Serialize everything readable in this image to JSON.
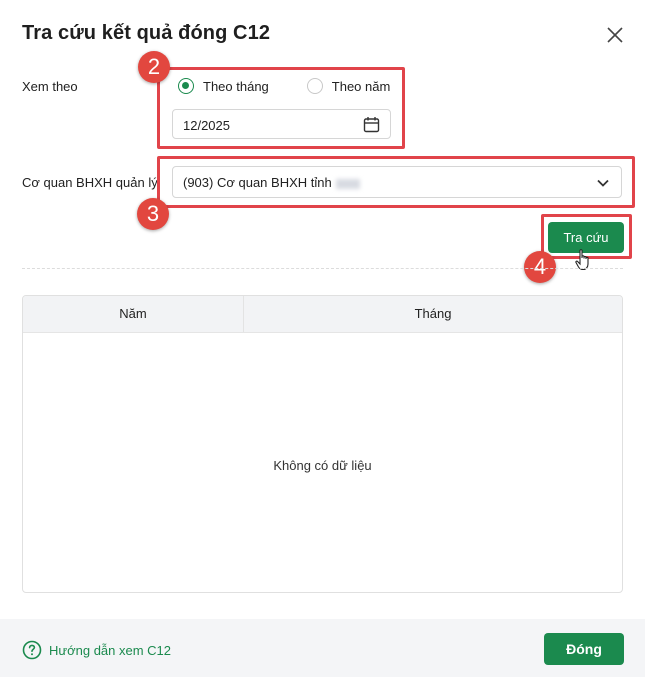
{
  "dialog": {
    "title": "Tra cứu kết quả đóng C12"
  },
  "filters": {
    "view_label": "Xem theo",
    "radio_month": "Theo tháng",
    "radio_year": "Theo năm",
    "selected": "Theo tháng",
    "date_value": "12/2025",
    "agency_label": "Cơ quan BHXH quản lý",
    "agency_value": "(903) Cơ quan BHXH tỉnh"
  },
  "actions": {
    "search_button": "Tra cứu"
  },
  "annotations": {
    "step2": "2",
    "step3": "3",
    "step4": "4",
    "highlight_color": "#e1444a"
  },
  "table": {
    "columns": [
      "Năm",
      "Tháng"
    ],
    "empty_text": "Không có dữ liệu"
  },
  "footer": {
    "help_link": "Hướng dẫn xem C12",
    "close_button": "Đóng"
  },
  "colors": {
    "accent": "#1b8a4e",
    "annotation": "#e2473f"
  },
  "icons": [
    "close-icon",
    "calendar-icon",
    "chevron-down-icon",
    "help-circle-icon",
    "hand-cursor-icon"
  ]
}
